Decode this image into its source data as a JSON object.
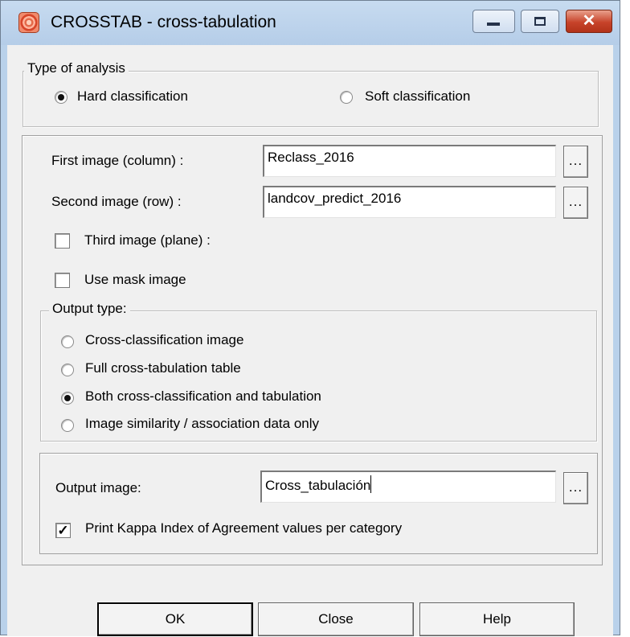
{
  "window": {
    "title": "CROSSTAB - cross-tabulation"
  },
  "analysis": {
    "legend": "Type of analysis",
    "options": [
      {
        "label": "Hard classification",
        "selected": true
      },
      {
        "label": "Soft classification",
        "selected": false
      }
    ]
  },
  "inputs": {
    "first_image": {
      "label": "First image (column) :",
      "value": "Reclass_2016",
      "browse": "..."
    },
    "second_image": {
      "label": "Second image (row) :",
      "value": "landcov_predict_2016",
      "browse": "..."
    },
    "third_image": {
      "label": "Third image (plane) :",
      "checked": false
    },
    "mask_image": {
      "label": "Use mask image",
      "checked": false
    }
  },
  "output_type": {
    "legend": "Output type:",
    "options": [
      {
        "label": "Cross-classification image",
        "selected": false
      },
      {
        "label": "Full cross-tabulation table",
        "selected": false
      },
      {
        "label": "Both cross-classification and tabulation",
        "selected": true
      },
      {
        "label": "Image similarity / association data only",
        "selected": false
      }
    ]
  },
  "output": {
    "label": "Output image:",
    "value": "Cross_tabulación",
    "browse": "...",
    "kappa": {
      "label": "Print Kappa Index of Agreement values per category",
      "checked": true,
      "mark": "✓"
    }
  },
  "buttons": {
    "ok": "OK",
    "close": "Close",
    "help": "Help"
  },
  "icons": {
    "app": "crosstab-app-icon",
    "minimize": "minimize-icon",
    "maximize": "maximize-icon",
    "close": "close-icon"
  }
}
